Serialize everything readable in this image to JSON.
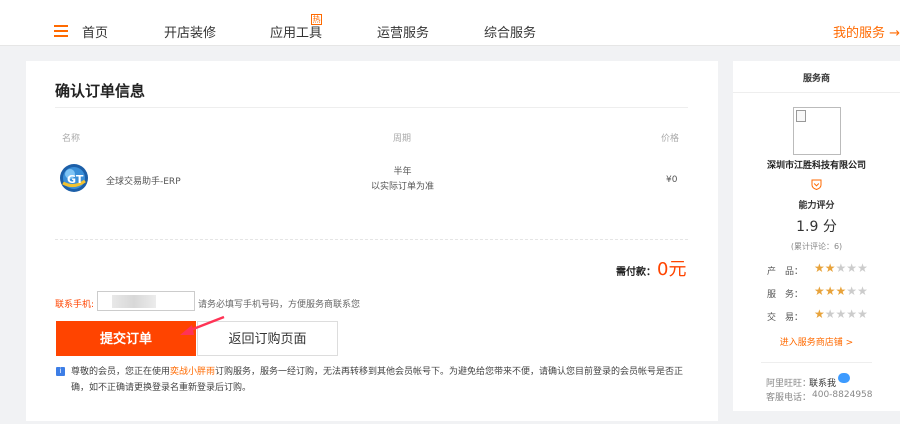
{
  "nav": {
    "items": [
      {
        "label": "首页"
      },
      {
        "label": "开店装修"
      },
      {
        "label": "应用工具"
      },
      {
        "label": "运营服务"
      },
      {
        "label": "综合服务"
      }
    ],
    "badge": "热",
    "my_service": "我的服务 →"
  },
  "order": {
    "title": "确认订单信息",
    "columns": {
      "name": "名称",
      "period": "周期",
      "price": "价格"
    },
    "product": {
      "name": "全球交易助手-ERP",
      "period_line1": "半年",
      "period_line2": "以实际订单为准",
      "price": "¥0"
    },
    "need_pay_label": "需付款：",
    "need_pay_amount": "0元",
    "phone_label": "联系手机:",
    "phone_hint": "请务必填写手机号码，方便服务商联系您",
    "submit_label": "提交订单",
    "back_label": "返回订购页面",
    "notice_pre": "尊敬的会员，您正在使用",
    "notice_highlight": "奕战小胖雨",
    "notice_post": "订购服务，服务一经订购，无法再转移到其他会员帐号下。为避免给您带来不便，请确认您目前登录的会员帐号是否正确，如不正确请更换登录名重新登录后订购。",
    "info_icon": "i"
  },
  "provider": {
    "title": "服务商",
    "company": "深圳市江胜科技有限公司",
    "ability_label": "能力评分",
    "score": "1.9 分",
    "reviews": "(累计评论：6)",
    "ratings": [
      {
        "label": "产　品：",
        "stars": 2
      },
      {
        "label": "服　务：",
        "stars": 3
      },
      {
        "label": "交　易：",
        "stars": 1
      }
    ],
    "enter_shop": "进入服务商店铺 >",
    "wangwang_label": "阿里旺旺：",
    "wangwang_value": "联系我",
    "tel_label": "客服电话：",
    "tel_value": "400-8824958"
  },
  "colors": {
    "accent": "#ff6a00",
    "submit": "#ff4400",
    "star": "#e8a33b"
  }
}
